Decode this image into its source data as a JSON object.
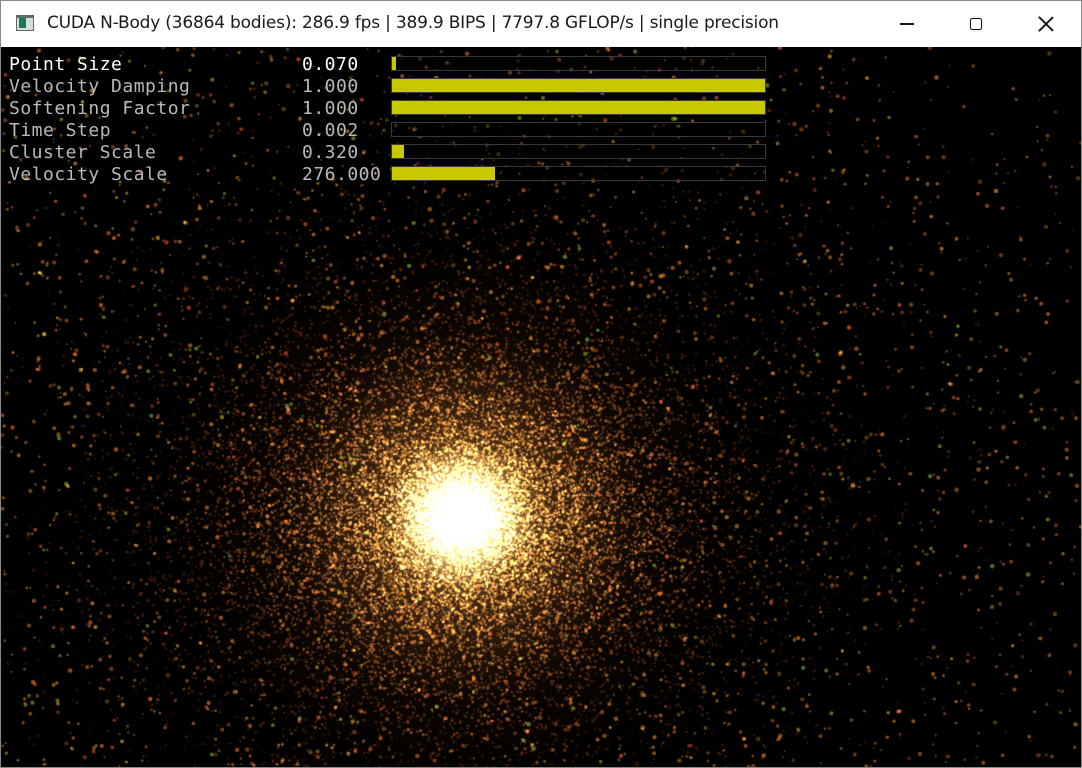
{
  "window": {
    "title": "CUDA N-Body (36864 bodies): 286.9 fps | 389.9 BIPS | 7797.8 GFLOP/s | single precision",
    "app_icon": "app-window-icon",
    "controls": {
      "minimize_icon": "minimize-icon",
      "maximize_icon": "maximize-icon",
      "close_icon": "close-icon"
    }
  },
  "parameters": [
    {
      "label": "Point Size",
      "value": "0.070",
      "fraction": 0.01
    },
    {
      "label": "Velocity Damping",
      "value": "1.000",
      "fraction": 1.0
    },
    {
      "label": "Softening Factor",
      "value": "1.000",
      "fraction": 1.0
    },
    {
      "label": "Time Step",
      "value": "0.002",
      "fraction": 0.0
    },
    {
      "label": "Cluster Scale",
      "value": "0.320",
      "fraction": 0.032
    },
    {
      "label": "Velocity Scale",
      "value": "276.000",
      "fraction": 0.276
    }
  ],
  "colors": {
    "slider_fill": "#c8c800",
    "background": "#000000"
  }
}
